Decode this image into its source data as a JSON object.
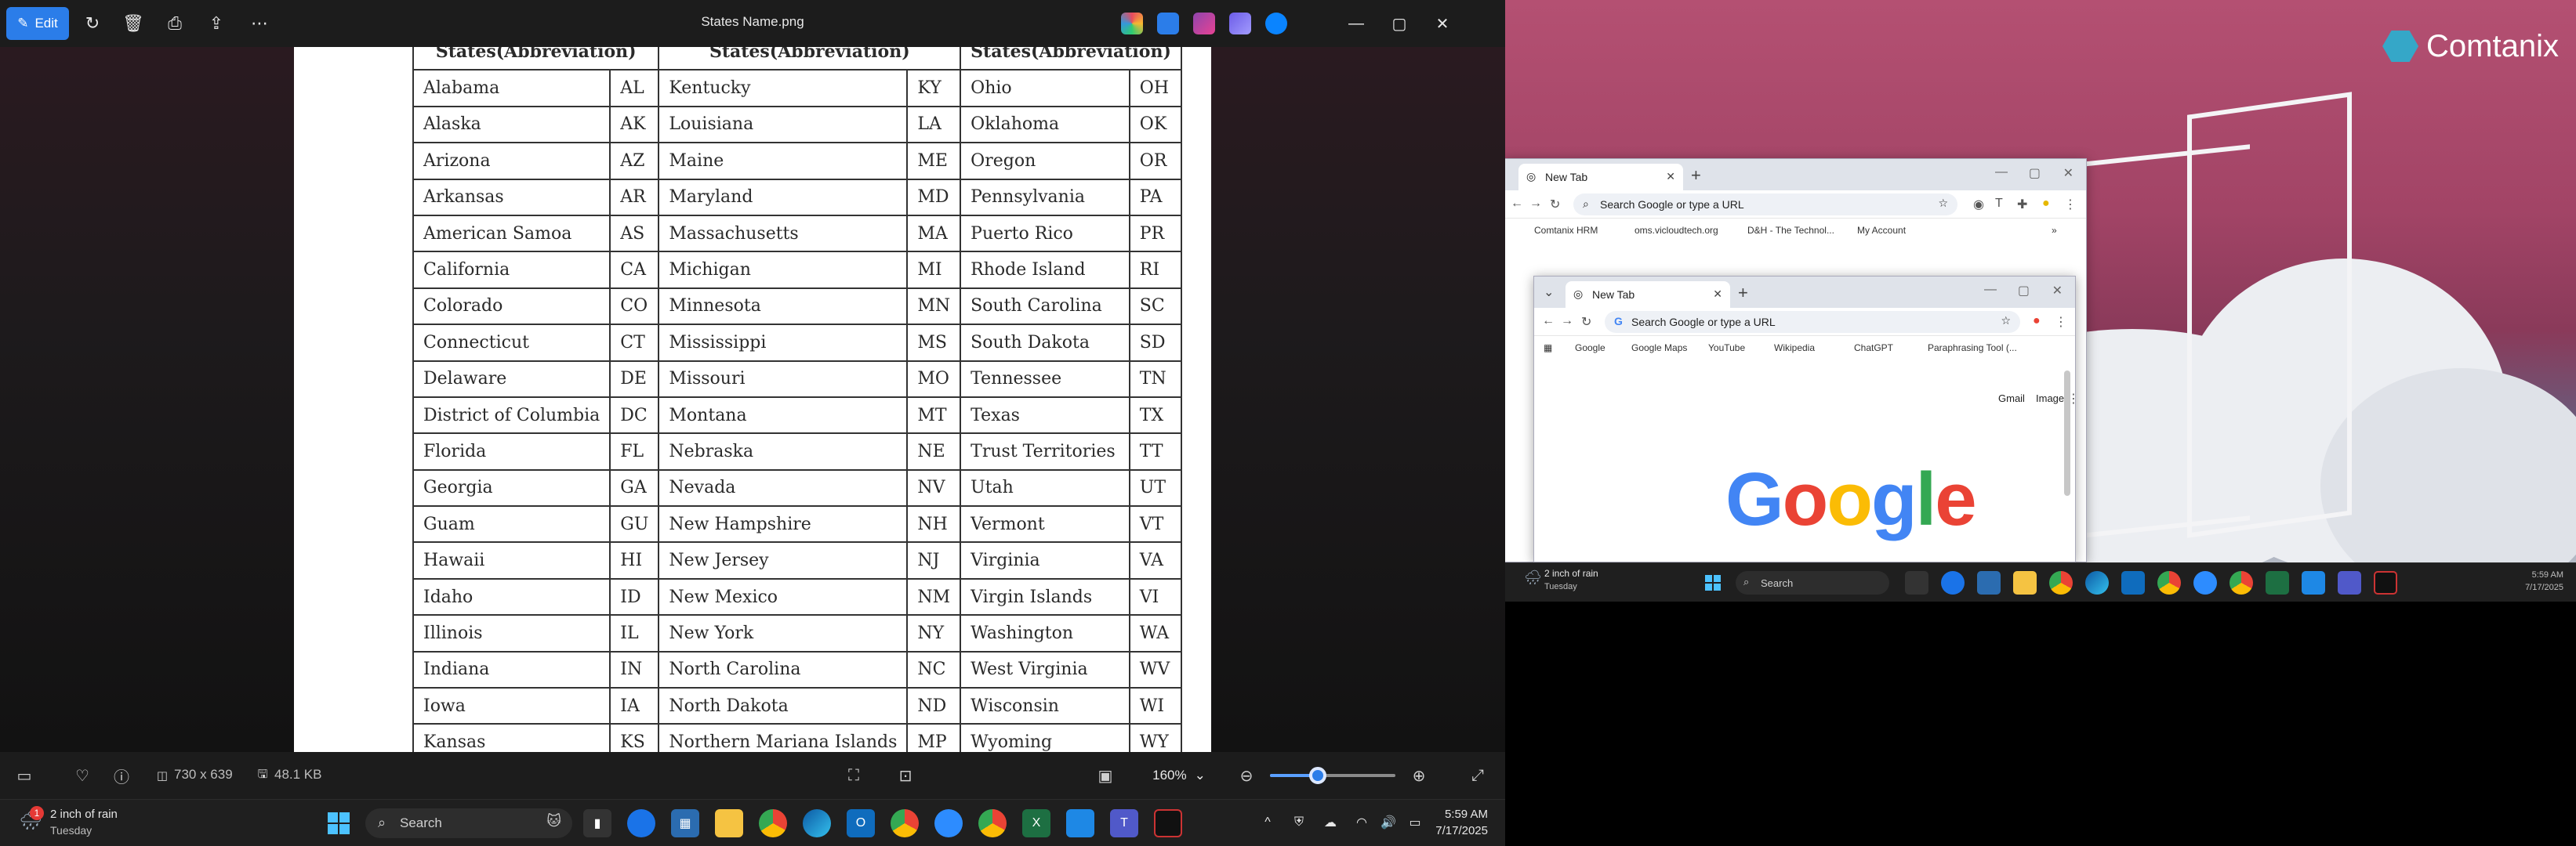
{
  "photos": {
    "title": "States Name.png",
    "edit_label": "Edit",
    "image_dims": "730 x 639",
    "file_size": "48.1 KB",
    "zoom": "160%",
    "zoom_fraction": 0.38,
    "header_clipped": [
      "States(Abbreviation)",
      "States(Abbreviation)",
      "States(Abbreviation)"
    ],
    "rows": [
      [
        "Alabama",
        "AL",
        "Kentucky",
        "KY",
        "Ohio",
        "OH"
      ],
      [
        "Alaska",
        "AK",
        "Louisiana",
        "LA",
        "Oklahoma",
        "OK"
      ],
      [
        "Arizona",
        "AZ",
        "Maine",
        "ME",
        "Oregon",
        "OR"
      ],
      [
        "Arkansas",
        "AR",
        "Maryland",
        "MD",
        "Pennsylvania",
        "PA"
      ],
      [
        "American Samoa",
        "AS",
        "Massachusetts",
        "MA",
        "Puerto Rico",
        "PR"
      ],
      [
        "California",
        "CA",
        "Michigan",
        "MI",
        "Rhode Island",
        "RI"
      ],
      [
        "Colorado",
        "CO",
        "Minnesota",
        "MN",
        "South Carolina",
        "SC"
      ],
      [
        "Connecticut",
        "CT",
        "Mississippi",
        "MS",
        "South Dakota",
        "SD"
      ],
      [
        "Delaware",
        "DE",
        "Missouri",
        "MO",
        "Tennessee",
        "TN"
      ],
      [
        "District of Columbia",
        "DC",
        "Montana",
        "MT",
        "Texas",
        "TX"
      ],
      [
        "Florida",
        "FL",
        "Nebraska",
        "NE",
        "Trust Territories",
        "TT"
      ],
      [
        "Georgia",
        "GA",
        "Nevada",
        "NV",
        "Utah",
        "UT"
      ],
      [
        "Guam",
        "GU",
        "New Hampshire",
        "NH",
        "Vermont",
        "VT"
      ],
      [
        "Hawaii",
        "HI",
        "New Jersey",
        "NJ",
        "Virginia",
        "VA"
      ],
      [
        "Idaho",
        "ID",
        "New Mexico",
        "NM",
        "Virgin Islands",
        "VI"
      ],
      [
        "Illinois",
        "IL",
        "New York",
        "NY",
        "Washington",
        "WA"
      ],
      [
        "Indiana",
        "IN",
        "North Carolina",
        "NC",
        "West Virginia",
        "WV"
      ],
      [
        "Iowa",
        "IA",
        "North Dakota",
        "ND",
        "Wisconsin",
        "WI"
      ],
      [
        "Kansas",
        "KS",
        "Northern Mariana Islands",
        "MP",
        "Wyoming",
        "WY"
      ]
    ]
  },
  "taskbar": {
    "weather_line1": "2 inch of rain",
    "weather_line2": "Tuesday",
    "weather_badge": "1",
    "search_label": "Search",
    "time": "5:59 AM",
    "date": "7/17/2025"
  },
  "desktop": {
    "brand": "Comtanix"
  },
  "chrome_back": {
    "tab_title": "New Tab",
    "omnibox": "Search Google or type a URL",
    "bookmarks": [
      "Comtanix HRM",
      "oms.vicloudtech.org",
      "D&H - The Technol...",
      "My Account"
    ]
  },
  "chrome_front": {
    "tab_title": "New Tab",
    "omnibox": "Search Google or type a URL",
    "bookmarks": [
      "Google",
      "Google Maps",
      "YouTube",
      "Wikipedia",
      "ChatGPT",
      "Paraphrasing Tool (..."
    ],
    "links": [
      "Gmail",
      "Images"
    ],
    "logo": "Google"
  },
  "taskbar2": {
    "weather_line1": "2 inch of rain",
    "weather_line2": "Tuesday",
    "search_label": "Search",
    "time": "5:59 AM",
    "date": "7/17/2025"
  },
  "colors": {
    "accent": "#2b7de9",
    "g_blue": "#4285f4",
    "g_red": "#ea4335",
    "g_yellow": "#fbbc05",
    "g_green": "#34a853"
  }
}
